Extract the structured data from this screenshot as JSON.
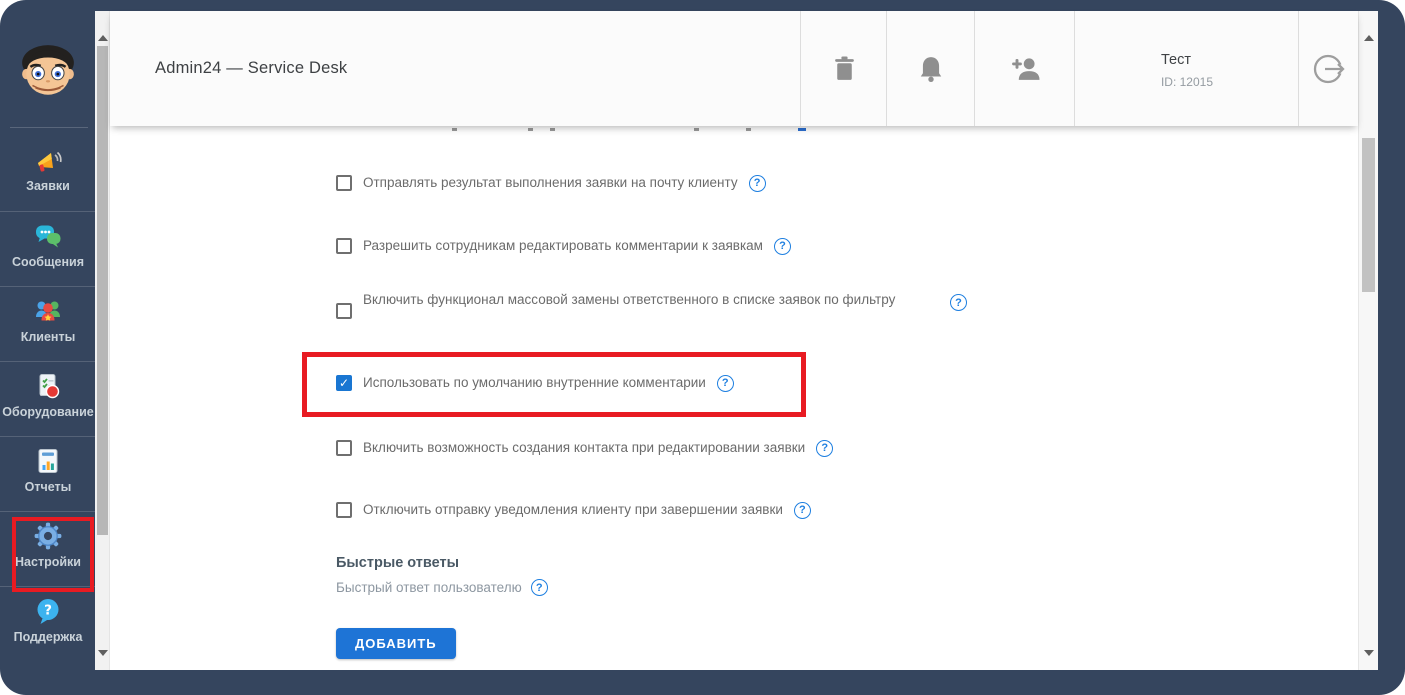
{
  "header": {
    "title": "Admin24 — Service Desk",
    "toolbar": [
      {
        "icon": "trash-icon"
      },
      {
        "icon": "bell-icon"
      },
      {
        "icon": "person-add-icon"
      }
    ],
    "user": {
      "name": "Тест",
      "id": "ID: 12015"
    },
    "logout": {
      "icon": "logout-icon"
    }
  },
  "sidebar": {
    "items": [
      {
        "id": "zayavki",
        "label": "Заявки",
        "icon": "megaphone-icon",
        "highlighted": false
      },
      {
        "id": "soobshcheniya",
        "label": "Сообщения",
        "icon": "chat-icon",
        "highlighted": false
      },
      {
        "id": "klienty",
        "label": "Клиенты",
        "icon": "people-icon",
        "highlighted": false
      },
      {
        "id": "oborudovanie",
        "label": "Оборудование",
        "icon": "equipment-icon",
        "highlighted": false
      },
      {
        "id": "otchety",
        "label": "Отчеты",
        "icon": "reports-icon",
        "highlighted": false
      },
      {
        "id": "nastroyki",
        "label": "Настройки",
        "icon": "gear-icon",
        "highlighted": true
      },
      {
        "id": "podderzhka",
        "label": "Поддержка",
        "icon": "support-icon",
        "highlighted": false
      }
    ]
  },
  "settings": {
    "partial_row_clipped_at_top": true,
    "checkboxes": [
      {
        "label": "Отправлять результат выполнения заявки на почту клиенту",
        "checked": false,
        "help": true,
        "highlighted": false
      },
      {
        "label": "Разрешить сотрудникам редактировать комментарии к заявкам",
        "checked": false,
        "help": true,
        "highlighted": false
      },
      {
        "label": "Включить функционал массовой замены ответственного в списке заявок по фильтру",
        "checked": false,
        "help": true,
        "highlighted": false
      },
      {
        "label": "Использовать по умолчанию внутренние комментарии",
        "checked": true,
        "help": true,
        "highlighted": true
      },
      {
        "label": "Включить возможность создания контакта при редактировании заявки",
        "checked": false,
        "help": true,
        "highlighted": false
      },
      {
        "label": "Отключить отправку уведомления клиенту при завершении заявки",
        "checked": false,
        "help": true,
        "highlighted": false
      }
    ],
    "quick_replies": {
      "heading": "Быстрые ответы",
      "description": "Быстрый ответ пользователю",
      "help": true,
      "add_button": "ДОБАВИТЬ"
    }
  },
  "colors": {
    "frame": "#35455e",
    "accent_blue": "#1e74d6",
    "checkbox_checked": "#1976d2",
    "help_icon": "#1e7fe0",
    "highlight_red": "#e81b22"
  }
}
